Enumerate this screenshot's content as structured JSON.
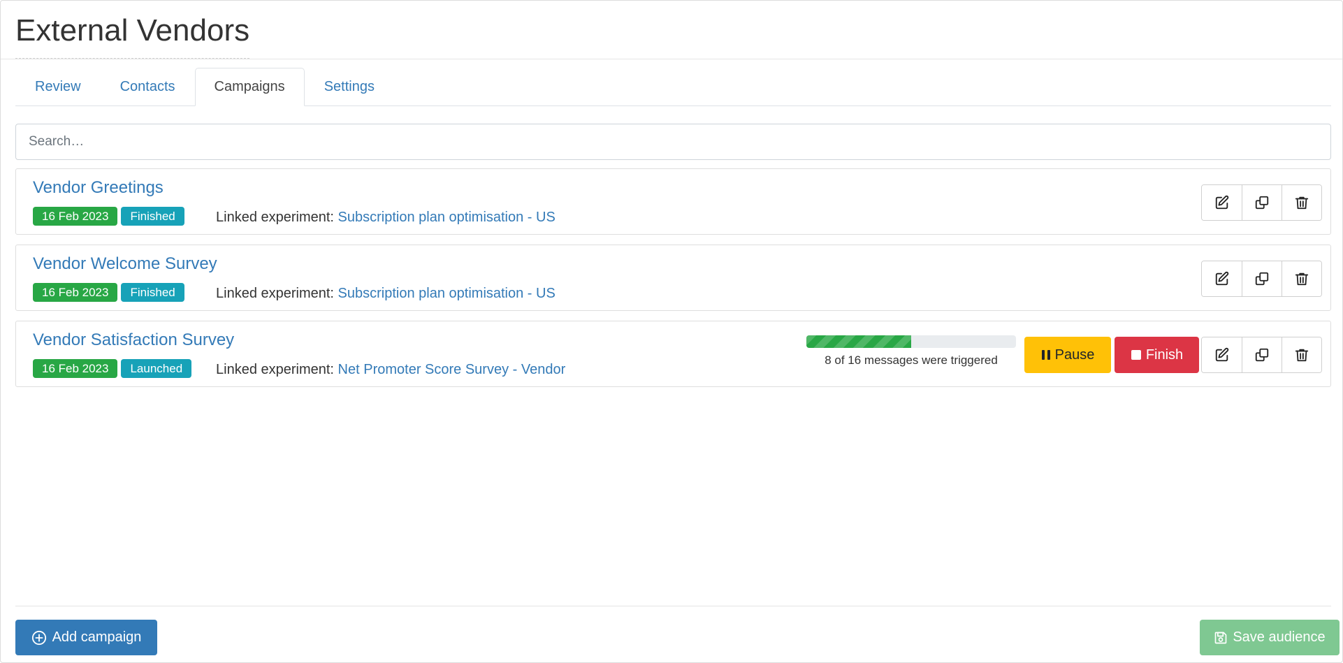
{
  "page": {
    "title": "External Vendors"
  },
  "tabs": [
    {
      "label": "Review",
      "active": false
    },
    {
      "label": "Contacts",
      "active": false
    },
    {
      "label": "Campaigns",
      "active": true
    },
    {
      "label": "Settings",
      "active": false
    }
  ],
  "search": {
    "placeholder": "Search…",
    "value": ""
  },
  "campaigns": [
    {
      "name": "Vendor Greetings",
      "date": "16 Feb 2023",
      "status": "Finished",
      "linked_label": "Linked experiment:",
      "linked_experiment": "Subscription plan optimisation - US"
    },
    {
      "name": "Vendor Welcome Survey",
      "date": "16 Feb 2023",
      "status": "Finished",
      "linked_label": "Linked experiment:",
      "linked_experiment": "Subscription plan optimisation - US"
    },
    {
      "name": "Vendor Satisfaction Survey",
      "date": "16 Feb 2023",
      "status": "Launched",
      "linked_label": "Linked experiment:",
      "linked_experiment": "Net Promoter Score Survey - Vendor",
      "progress": {
        "triggered": 8,
        "total": 16,
        "caption": "8 of 16 messages were triggered",
        "fraction": 0.5
      },
      "pause_label": "Pause",
      "finish_label": "Finish"
    }
  ],
  "footer": {
    "add_label": "Add campaign",
    "save_label": "Save audience"
  },
  "colors": {
    "link": "#337ab7",
    "date_badge": "#28a745",
    "status_badge": "#17a2b8",
    "pause": "#ffc107",
    "finish": "#dc3545",
    "save_disabled": "#7fc892"
  },
  "icons": [
    "edit-icon",
    "copy-icon",
    "trash-icon",
    "pause-icon",
    "stop-icon",
    "plus-circle-icon",
    "save-icon"
  ]
}
